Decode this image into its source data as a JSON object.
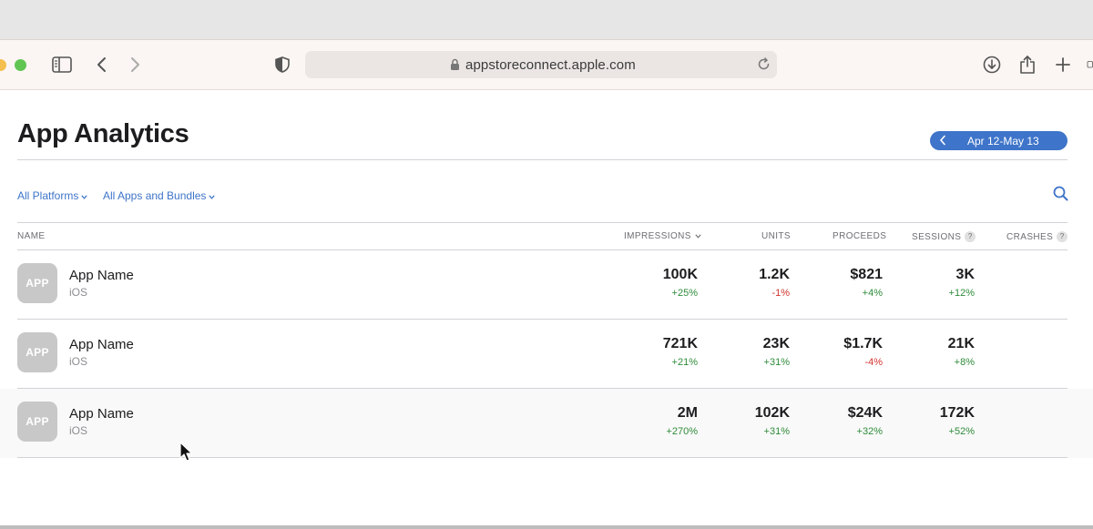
{
  "browser": {
    "url": "appstoreconnect.apple.com",
    "icons": [
      "sidebar-icon",
      "back-icon",
      "forward-icon",
      "shield-icon",
      "lock-icon",
      "reload-icon",
      "download-icon",
      "share-icon",
      "new-tab-icon",
      "tab-overview-icon"
    ]
  },
  "page": {
    "title": "App Analytics",
    "date_range": "Apr 12-May 13"
  },
  "filters": {
    "platforms": "All Platforms",
    "apps": "All Apps and Bundles"
  },
  "table": {
    "headers": {
      "name": "NAME",
      "impressions": "IMPRESSIONS",
      "units": "UNITS",
      "proceeds": "PROCEEDS",
      "sessions": "SESSIONS",
      "crashes": "CRASHES",
      "help": "?"
    },
    "rows": [
      {
        "icon": "APP",
        "name": "App Name",
        "platform": "iOS",
        "impressions": "100K",
        "impressions_change": "+25%",
        "units": "1.2K",
        "units_change": "-1%",
        "proceeds": "$821",
        "proceeds_change": "+4%",
        "sessions": "3K",
        "sessions_change": "+12%"
      },
      {
        "icon": "APP",
        "name": "App Name",
        "platform": "iOS",
        "impressions": "721K",
        "impressions_change": "+21%",
        "units": "23K",
        "units_change": "+31%",
        "proceeds": "$1.7K",
        "proceeds_change": "-4%",
        "sessions": "21K",
        "sessions_change": "+8%"
      },
      {
        "icon": "APP",
        "name": "App Name",
        "platform": "iOS",
        "impressions": "2M",
        "impressions_change": "+270%",
        "units": "102K",
        "units_change": "+31%",
        "proceeds": "$24K",
        "proceeds_change": "+32%",
        "sessions": "172K",
        "sessions_change": "+52%"
      }
    ]
  },
  "colors": {
    "accent": "#3e74c9",
    "positive": "#2e8b3a",
    "negative": "#d1342f"
  }
}
